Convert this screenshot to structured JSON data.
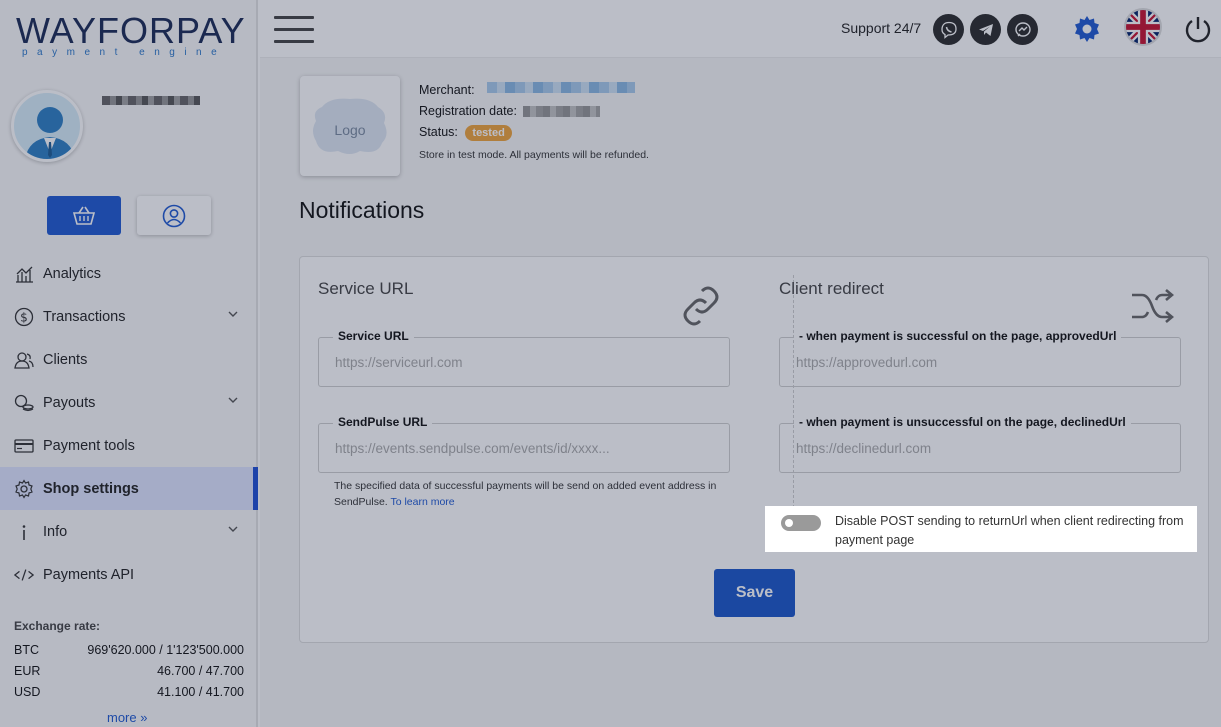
{
  "brand": {
    "name": "WAYFORPAY",
    "tagline": "payment engine"
  },
  "sidebar": {
    "items": [
      {
        "label": "Analytics",
        "icon": "analytics-icon"
      },
      {
        "label": "Transactions",
        "icon": "dollar-icon",
        "expandable": true
      },
      {
        "label": "Clients",
        "icon": "clients-icon"
      },
      {
        "label": "Payouts",
        "icon": "payouts-icon",
        "expandable": true
      },
      {
        "label": "Payment tools",
        "icon": "card-icon"
      },
      {
        "label": "Shop settings",
        "icon": "gear-icon",
        "active": true
      },
      {
        "label": "Info",
        "icon": "info-icon",
        "expandable": true
      },
      {
        "label": "Payments API",
        "icon": "code-icon"
      }
    ],
    "exchange": {
      "title": "Exchange rate:",
      "rows": [
        {
          "currency": "BTC",
          "value": "969'620.000 / 1'123'500.000"
        },
        {
          "currency": "EUR",
          "value": "46.700 / 47.700"
        },
        {
          "currency": "USD",
          "value": "41.100 / 41.700"
        }
      ],
      "more": "more"
    }
  },
  "header": {
    "support": "Support 24/7",
    "language": "English (UK)"
  },
  "merchant": {
    "logo": "Logo",
    "merchant_label": "Merchant:",
    "registration_label": "Registration date:",
    "status_label": "Status:",
    "status": "tested",
    "note": "Store in test mode. All payments will be refunded."
  },
  "page": {
    "title": "Notifications"
  },
  "service": {
    "title": "Service URL",
    "service_url_label": "Service URL",
    "service_url_placeholder": "https://serviceurl.com",
    "sendpulse_label": "SendPulse URL",
    "sendpulse_placeholder": "https://events.sendpulse.com/events/id/xxxx...",
    "helper_text": "The specified data of successful payments will be send on added event address in SendPulse.",
    "helper_link": "To learn more"
  },
  "redirect": {
    "title": "Client redirect",
    "approved_label": "- when payment is successful on the page, approvedUrl",
    "approved_placeholder": "https://approvedurl.com",
    "declined_label": "- when payment is unsuccessful on the page, declinedUrl",
    "declined_placeholder": "https://declinedurl.com",
    "toggle_label": "Disable POST sending to returnUrl when client redirecting from payment page",
    "toggle_on": false
  },
  "actions": {
    "save": "Save"
  },
  "colors": {
    "accent": "#1f5ad1",
    "status": "#f0a43a",
    "active_nav": "#e0e6ff"
  }
}
